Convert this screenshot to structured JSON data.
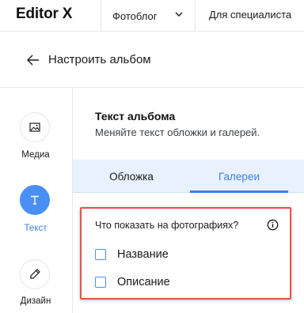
{
  "topbar": {
    "logo": "Editor X",
    "site_name": "Фотоблог",
    "mode_link": "Для специалиста"
  },
  "header": {
    "title": "Настроить альбом"
  },
  "rail": {
    "items": [
      {
        "label": "Медиа",
        "icon": "image-icon"
      },
      {
        "label": "Текст",
        "icon": "text-icon",
        "active": true
      },
      {
        "label": "Дизайн",
        "icon": "brush-icon"
      }
    ]
  },
  "section": {
    "title": "Текст альбома",
    "subtitle": "Меняйте текст обложки и галерей."
  },
  "tabs": [
    {
      "label": "Обложка"
    },
    {
      "label": "Галереи",
      "selected": true
    }
  ],
  "panel": {
    "question": "Что показать на фотографиях?",
    "options": [
      {
        "label": "Название",
        "checked": false
      },
      {
        "label": "Описание",
        "checked": false
      }
    ]
  },
  "colors": {
    "accent": "#3a7ff0",
    "highlight_border": "#e4524c",
    "tabs_background": "#e8f1fd"
  }
}
